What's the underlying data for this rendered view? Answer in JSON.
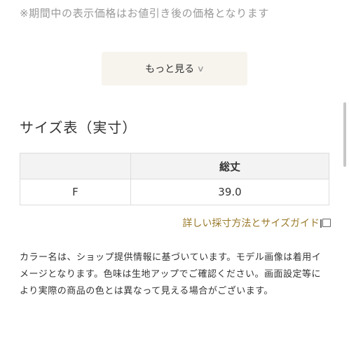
{
  "notice": {
    "text": "※期間中の表示価格はお値引き後の価格となります"
  },
  "more_button": {
    "label": "もっと見る",
    "icon": "chevron-down-icon"
  },
  "size_chart": {
    "title": "サイズ表（実寸）",
    "columns": [
      "",
      "総丈"
    ],
    "rows": [
      {
        "size": "F",
        "total_length": "39.0"
      }
    ]
  },
  "guide_link": {
    "label": "詳しい採寸方法とサイズガイド",
    "icon": "external-window-icon",
    "color": "#9a7a2a"
  },
  "description": {
    "text": "カラー名は、ショップ提供情報に基づいています。モデル画像は着用イメージとなります。色味は生地アップでご確認ください。画面設定等により実際の商品の色とは異なって見える場合がございます。"
  }
}
